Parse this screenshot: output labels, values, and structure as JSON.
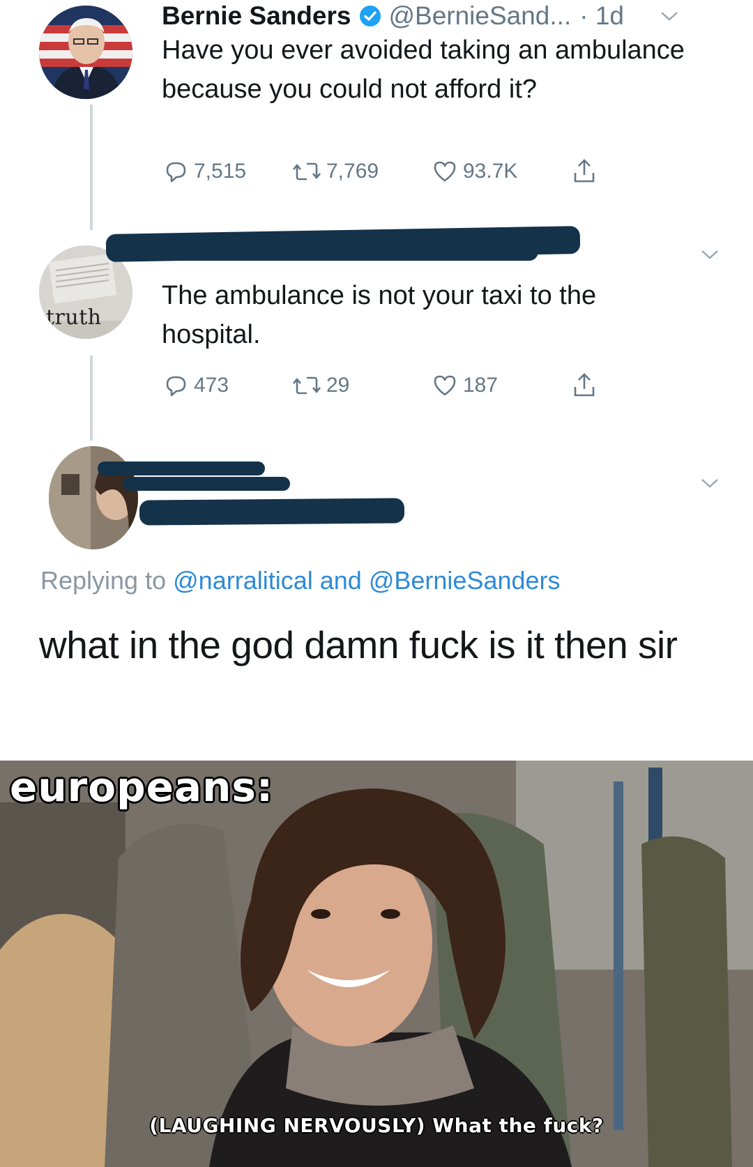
{
  "tweets": [
    {
      "name": "Bernie Sanders",
      "handle": "@BernieSand...",
      "time": "· 1d",
      "text": "Have you ever avoided taking an ambulance because you could not afford it?",
      "replies": "7,515",
      "retweets": "7,769",
      "likes": "93.7K"
    },
    {
      "avatar_text": "truth",
      "text": "The ambulance is not your taxi to the hospital.",
      "replies": "473",
      "retweets": "29",
      "likes": "187"
    },
    {
      "replying_prefix": "Replying to",
      "mention1": "@narralitical",
      "replying_and": "and",
      "mention2": "@BernieSanders",
      "text": "what in the god damn fuck is it then sir"
    }
  ],
  "meme": {
    "label": "europeans:",
    "subtitle": "(LAUGHING NERVOUSLY) What the fuck?"
  },
  "colors": {
    "verified": "#1da1f2",
    "mention": "#2d8ad6",
    "redaction": "#14324a"
  }
}
